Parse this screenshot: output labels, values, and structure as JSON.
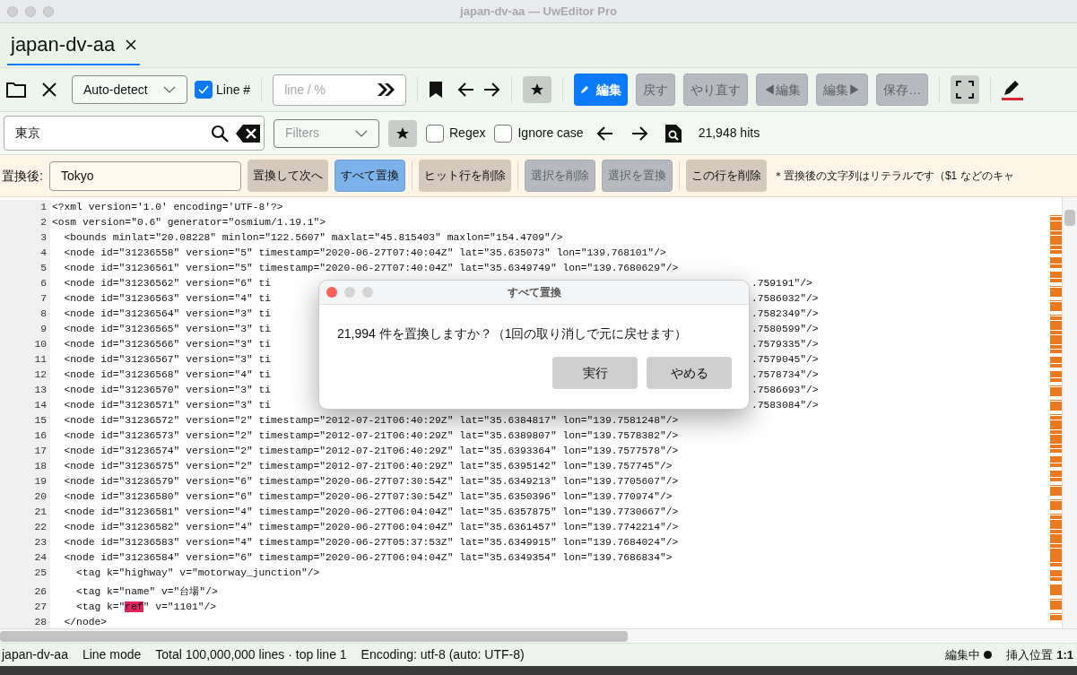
{
  "window": {
    "title": "japan-dv-aa — UwEditor Pro"
  },
  "tabs": [
    {
      "label": "japan-dv-aa",
      "selected": true
    }
  ],
  "toolbar": {
    "encoding": "Auto-detect",
    "line_numbers": {
      "label": "Line #",
      "checked": true
    },
    "goto_placeholder": "line / %",
    "edit_buttons": [
      {
        "label": "編集",
        "active": true,
        "disabled": false
      },
      {
        "label": "戻す",
        "active": false,
        "disabled": true
      },
      {
        "label": "やり直す",
        "active": false,
        "disabled": true
      },
      {
        "label": "◀編集",
        "active": false,
        "disabled": true
      },
      {
        "label": "編集▶",
        "active": false,
        "disabled": true
      },
      {
        "label": "保存…",
        "active": false,
        "disabled": true
      }
    ]
  },
  "search": {
    "value": "東京",
    "filters_placeholder": "Filters",
    "regex": {
      "label": "Regex",
      "checked": false
    },
    "ignore_case": {
      "label": "Ignore case",
      "checked": false
    },
    "hits": "21,948 hits"
  },
  "replace": {
    "label": "置換後:",
    "value": "Tokyo",
    "button_groups": [
      [
        {
          "label": "置換して次へ",
          "primary": false,
          "disabled": false
        },
        {
          "label": "すべて置換",
          "primary": true,
          "disabled": false
        }
      ],
      [
        {
          "label": "ヒット行を削除",
          "primary": false,
          "disabled": false
        }
      ],
      [
        {
          "label": "選択を削除",
          "disabled": true
        },
        {
          "label": "選択を置換",
          "disabled": true
        }
      ],
      [
        {
          "label": "この行を削除",
          "primary": false,
          "disabled": false
        }
      ]
    ],
    "note": "＊置換後の文字列はリテラルです（$1 などのキャ"
  },
  "code_lines": [
    {
      "n": "1",
      "text": "<?xml version='1.0' encoding='UTF-8'?>"
    },
    {
      "n": "2",
      "text": "<osm version=\"0.6\" generator=\"osmium/1.19.1\">"
    },
    {
      "n": "3",
      "text": "  <bounds minlat=\"20.08228\" minlon=\"122.5607\" maxlat=\"45.815403\" maxlon=\"154.4709\"/>"
    },
    {
      "n": "4",
      "text": "  <node id=\"31236558\" version=\"5\" timestamp=\"2020-06-27T07:40:04Z\" lat=\"35.635073\" lon=\"139.768101\"/>"
    },
    {
      "n": "5",
      "text": "  <node id=\"31236561\" version=\"5\" timestamp=\"2020-06-27T07:40:04Z\" lat=\"35.6349749\" lon=\"139.7680629\"/>"
    },
    {
      "n": "6",
      "text": "  <node id=\"31236562\" version=\"6\" ti",
      "tail": ".759191\"/>"
    },
    {
      "n": "7",
      "text": "  <node id=\"31236563\" version=\"4\" ti",
      "tail": ".7586032\"/>"
    },
    {
      "n": "8",
      "text": "  <node id=\"31236564\" version=\"3\" ti",
      "tail": ".7582349\"/>"
    },
    {
      "n": "9",
      "text": "  <node id=\"31236565\" version=\"3\" ti",
      "tail": ".7580599\"/>"
    },
    {
      "n": "10",
      "text": "  <node id=\"31236566\" version=\"3\" ti",
      "tail": ".7579335\"/>"
    },
    {
      "n": "11",
      "text": "  <node id=\"31236567\" version=\"3\" ti",
      "tail": ".7579045\"/>"
    },
    {
      "n": "12",
      "text": "  <node id=\"31236568\" version=\"4\" ti",
      "tail": ".7578734\"/>"
    },
    {
      "n": "13",
      "text": "  <node id=\"31236570\" version=\"3\" ti",
      "tail": ".7586693\"/>"
    },
    {
      "n": "14",
      "text": "  <node id=\"31236571\" version=\"3\" ti",
      "tail": ".7583084\"/>"
    },
    {
      "n": "15",
      "text": "  <node id=\"31236572\" version=\"2\" timestamp=\"2012-07-21T06:40:29Z\" lat=\"35.6384817\" lon=\"139.7581248\"/>"
    },
    {
      "n": "16",
      "text": "  <node id=\"31236573\" version=\"2\" timestamp=\"2012-07-21T06:40:29Z\" lat=\"35.6389807\" lon=\"139.7578382\"/>"
    },
    {
      "n": "17",
      "text": "  <node id=\"31236574\" version=\"2\" timestamp=\"2012-07-21T06:40:29Z\" lat=\"35.6393364\" lon=\"139.7577578\"/>"
    },
    {
      "n": "18",
      "text": "  <node id=\"31236575\" version=\"2\" timestamp=\"2012-07-21T06:40:29Z\" lat=\"35.6395142\" lon=\"139.757745\"/>"
    },
    {
      "n": "19",
      "text": "  <node id=\"31236579\" version=\"6\" timestamp=\"2020-06-27T07:30:54Z\" lat=\"35.6349213\" lon=\"139.7705607\"/>"
    },
    {
      "n": "20",
      "text": "  <node id=\"31236580\" version=\"6\" timestamp=\"2020-06-27T07:30:54Z\" lat=\"35.6350396\" lon=\"139.770974\"/>"
    },
    {
      "n": "21",
      "text": "  <node id=\"31236581\" version=\"4\" timestamp=\"2020-06-27T06:04:04Z\" lat=\"35.6357875\" lon=\"139.7730667\"/>"
    },
    {
      "n": "22",
      "text": "  <node id=\"31236582\" version=\"4\" timestamp=\"2020-06-27T06:04:04Z\" lat=\"35.6361457\" lon=\"139.7742214\"/>"
    },
    {
      "n": "23",
      "text": "  <node id=\"31236583\" version=\"4\" timestamp=\"2020-06-27T05:37:53Z\" lat=\"35.6349915\" lon=\"139.7684024\"/>"
    },
    {
      "n": "24",
      "text": "  <node id=\"31236584\" version=\"6\" timestamp=\"2020-06-27T06:04:04Z\" lat=\"35.6349354\" lon=\"139.7686834\">"
    },
    {
      "n": "25",
      "text": "    <tag k=\"highway\" v=\"motorway_junction\"/>"
    },
    {
      "n": "26",
      "text": "    <tag k=\"name\" v=\"台場\"/>"
    },
    {
      "n": "27",
      "text": "    <tag k=\"",
      "match": "ref",
      "rest": "\" v=\"1101\"/>"
    },
    {
      "n": "28",
      "text": "  </node>"
    }
  ],
  "dialog": {
    "title": "すべて置換",
    "message": "21,994 件を置換しますか？（1回の取り消しで元に戻せます）",
    "buttons": [
      "実行",
      "やめる"
    ]
  },
  "status_bar": {
    "items": [
      "japan-dv-aa",
      "Line mode",
      "Total 100,000,000 lines · top line 1",
      "Encoding: utf-8 (auto: UTF-8)"
    ],
    "mode": "編集中",
    "position_label": "挿入位置",
    "position": "1:1"
  }
}
